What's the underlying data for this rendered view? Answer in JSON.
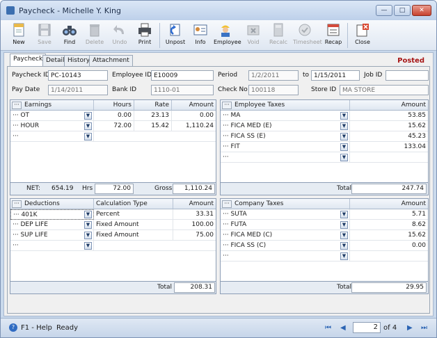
{
  "window": {
    "title": "Paycheck - Michelle Y. King"
  },
  "toolbar": [
    {
      "key": "new",
      "label": "New",
      "icon": "new-document-icon",
      "enabled": true
    },
    {
      "key": "save",
      "label": "Save",
      "icon": "floppy-disk-icon",
      "enabled": false
    },
    {
      "key": "find",
      "label": "Find",
      "icon": "binoculars-icon",
      "enabled": true
    },
    {
      "key": "delete",
      "label": "Delete",
      "icon": "trash-can-icon",
      "enabled": false
    },
    {
      "key": "undo",
      "label": "Undo",
      "icon": "undo-arrow-icon",
      "enabled": false
    },
    {
      "key": "print",
      "label": "Print",
      "icon": "printer-icon",
      "enabled": true
    },
    {
      "key": "unpost",
      "label": "Unpost",
      "icon": "unpost-icon",
      "enabled": true
    },
    {
      "key": "info",
      "label": "Info",
      "icon": "info-card-icon",
      "enabled": true
    },
    {
      "key": "employee",
      "label": "Employee",
      "icon": "employee-worker-icon",
      "enabled": true
    },
    {
      "key": "void",
      "label": "Void",
      "icon": "void-icon",
      "enabled": false
    },
    {
      "key": "recalc",
      "label": "Recalc",
      "icon": "calculator-icon",
      "enabled": false
    },
    {
      "key": "timesheet",
      "label": "Timesheet",
      "icon": "timesheet-icon",
      "enabled": false
    },
    {
      "key": "recap",
      "label": "Recap",
      "icon": "recap-report-icon",
      "enabled": true
    },
    {
      "key": "close",
      "label": "Close",
      "icon": "close-window-icon",
      "enabled": true
    }
  ],
  "tabs": [
    "Paycheck",
    "Detail",
    "History",
    "Attachment"
  ],
  "status": "Posted",
  "form": {
    "paycheck_id_label": "Paycheck ID",
    "paycheck_id": "PC-10143",
    "employee_id_label": "Employee ID",
    "employee_id": "E10009",
    "period_label": "Period",
    "period_from": "1/2/2011",
    "period_to_label": "to",
    "period_to": "1/15/2011",
    "job_id_label": "Job ID",
    "job_id": "",
    "pay_date_label": "Pay Date",
    "pay_date": "1/14/2011",
    "bank_id_label": "Bank ID",
    "bank_id": "1110-01",
    "check_no_label": "Check No",
    "check_no": "100118",
    "store_id_label": "Store ID",
    "store_id": "MA STORE"
  },
  "earnings": {
    "headers": [
      "Earnings",
      "Hours",
      "Rate",
      "Amount"
    ],
    "rows": [
      {
        "name": "OT",
        "hours": "0.00",
        "rate": "23.13",
        "amount": "0.00"
      },
      {
        "name": "HOUR",
        "hours": "72.00",
        "rate": "15.42",
        "amount": "1,110.24"
      }
    ],
    "footer": {
      "net_label": "NET:",
      "net": "654.19",
      "hrs_label": "Hrs",
      "hrs": "72.00",
      "gross_label": "Gross",
      "gross": "1,110.24"
    }
  },
  "employee_taxes": {
    "headers": [
      "Employee Taxes",
      "Amount"
    ],
    "rows": [
      {
        "name": "MA",
        "amount": "53.85"
      },
      {
        "name": "FICA MED (E)",
        "amount": "15.62"
      },
      {
        "name": "FICA SS (E)",
        "amount": "45.23"
      },
      {
        "name": "FIT",
        "amount": "133.04"
      }
    ],
    "footer": {
      "total_label": "Total",
      "total": "247.74"
    }
  },
  "deductions": {
    "headers": [
      "Deductions",
      "Calculation Type",
      "Amount"
    ],
    "rows": [
      {
        "name": "401K",
        "calc": "Percent",
        "amount": "33.31"
      },
      {
        "name": "DEP LIFE",
        "calc": "Fixed Amount",
        "amount": "100.00"
      },
      {
        "name": "SUP LIFE",
        "calc": "Fixed Amount",
        "amount": "75.00"
      }
    ],
    "footer": {
      "total_label": "Total",
      "total": "208.31"
    }
  },
  "company_taxes": {
    "headers": [
      "Company Taxes",
      "Amount"
    ],
    "rows": [
      {
        "name": "SUTA",
        "amount": "5.71"
      },
      {
        "name": "FUTA",
        "amount": "8.62"
      },
      {
        "name": "FICA MED (C)",
        "amount": "15.62"
      },
      {
        "name": "FICA SS (C)",
        "amount": "0.00"
      }
    ],
    "footer": {
      "total_label": "Total",
      "total": "29.95"
    }
  },
  "statusbar": {
    "help": "F1 - Help",
    "ready": "Ready",
    "page": "2",
    "of_label": "of 4"
  }
}
